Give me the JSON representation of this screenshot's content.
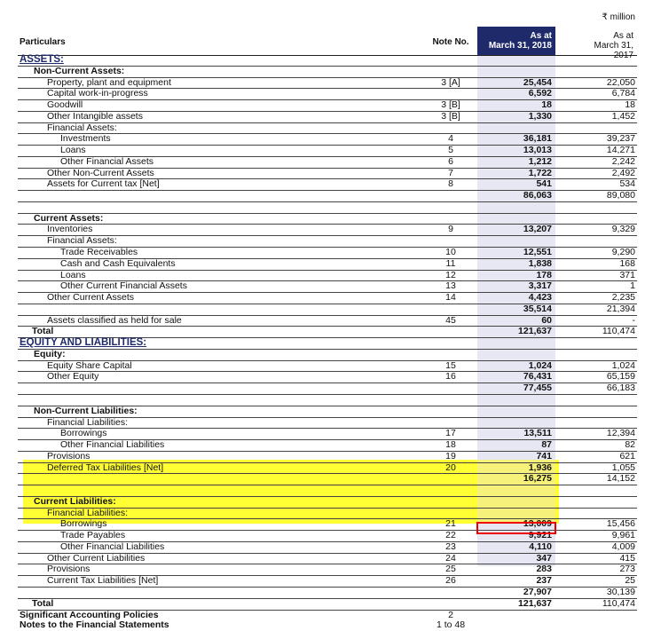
{
  "unit": "₹ million",
  "header": {
    "particulars": "Particulars",
    "note": "Note No.",
    "current_line1": "As at",
    "current_line2": "March 31, 2018",
    "previous_line1": "As at",
    "previous_line2": "March 31, 2017"
  },
  "colors": {
    "header_bg": "#1f2a6b",
    "highlight": "#ffff33",
    "red_box": "#e00000"
  },
  "rows": [
    {
      "level": "0",
      "label": "ASSETS:",
      "note": "",
      "cur": "",
      "prev": ""
    },
    {
      "level": "1",
      "label": "Non-Current Assets:",
      "note": "",
      "cur": "",
      "prev": ""
    },
    {
      "level": "2",
      "label": "Property, plant and equipment",
      "note": "3 [A]",
      "cur": "25,454",
      "prev": "22,050"
    },
    {
      "level": "2",
      "label": "Capital work-in-progress",
      "note": "",
      "cur": "6,592",
      "prev": "6,784"
    },
    {
      "level": "2",
      "label": "Goodwill",
      "note": "3 [B]",
      "cur": "18",
      "prev": "18"
    },
    {
      "level": "2",
      "label": "Other Intangible assets",
      "note": "3 [B]",
      "cur": "1,330",
      "prev": "1,452"
    },
    {
      "level": "2",
      "label": "Financial Assets:",
      "note": "",
      "cur": "",
      "prev": ""
    },
    {
      "level": "3",
      "label": "Investments",
      "note": "4",
      "cur": "36,181",
      "prev": "39,237"
    },
    {
      "level": "3",
      "label": "Loans",
      "note": "5",
      "cur": "13,013",
      "prev": "14,271"
    },
    {
      "level": "3",
      "label": "Other Financial Assets",
      "note": "6",
      "cur": "1,212",
      "prev": "2,242"
    },
    {
      "level": "2",
      "label": "Other Non-Current Assets",
      "note": "7",
      "cur": "1,722",
      "prev": "2,492"
    },
    {
      "level": "2",
      "label": "Assets for Current tax [Net]",
      "note": "8",
      "cur": "541",
      "prev": "534"
    },
    {
      "level": "s",
      "label": "",
      "note": "",
      "cur": "86,063",
      "prev": "89,080"
    },
    {
      "level": "e",
      "label": "",
      "note": "",
      "cur": "",
      "prev": ""
    },
    {
      "level": "1",
      "label": "Current Assets:",
      "note": "",
      "cur": "",
      "prev": ""
    },
    {
      "level": "2",
      "label": "Inventories",
      "note": "9",
      "cur": "13,207",
      "prev": "9,329"
    },
    {
      "level": "2",
      "label": "Financial Assets:",
      "note": "",
      "cur": "",
      "prev": ""
    },
    {
      "level": "3",
      "label": "Trade Receivables",
      "note": "10",
      "cur": "12,551",
      "prev": "9,290"
    },
    {
      "level": "3",
      "label": "Cash and Cash Equivalents",
      "note": "11",
      "cur": "1,838",
      "prev": "168"
    },
    {
      "level": "3",
      "label": "Loans",
      "note": "12",
      "cur": "178",
      "prev": "371"
    },
    {
      "level": "3",
      "label": "Other Current Financial Assets",
      "note": "13",
      "cur": "3,317",
      "prev": "1"
    },
    {
      "level": "2",
      "label": "Other Current Assets",
      "note": "14",
      "cur": "4,423",
      "prev": "2,235"
    },
    {
      "level": "s",
      "label": "",
      "note": "",
      "cur": "35,514",
      "prev": "21,394"
    },
    {
      "level": "2",
      "label": "Assets classified as held for sale",
      "note": "45",
      "cur": "60",
      "prev": "-"
    },
    {
      "level": "t",
      "label": "Total",
      "note": "",
      "cur": "121,637",
      "prev": "110,474"
    },
    {
      "level": "0",
      "label": "EQUITY AND LIABILITIES:",
      "note": "",
      "cur": "",
      "prev": ""
    },
    {
      "level": "1",
      "label": "Equity:",
      "note": "",
      "cur": "",
      "prev": ""
    },
    {
      "level": "2",
      "label": "Equity Share Capital",
      "note": "15",
      "cur": "1,024",
      "prev": "1,024"
    },
    {
      "level": "2",
      "label": "Other Equity",
      "note": "16",
      "cur": "76,431",
      "prev": "65,159"
    },
    {
      "level": "s",
      "label": "",
      "note": "",
      "cur": "77,455",
      "prev": "66,183"
    },
    {
      "level": "e",
      "label": "",
      "note": "",
      "cur": "",
      "prev": ""
    },
    {
      "level": "1",
      "label": "Non-Current Liabilities:",
      "note": "",
      "cur": "",
      "prev": ""
    },
    {
      "level": "2",
      "label": "Financial Liabilities:",
      "note": "",
      "cur": "",
      "prev": ""
    },
    {
      "level": "3",
      "label": "Borrowings",
      "note": "17",
      "cur": "13,511",
      "prev": "12,394"
    },
    {
      "level": "3",
      "label": "Other Financial Liabilities",
      "note": "18",
      "cur": "87",
      "prev": "82"
    },
    {
      "level": "2",
      "label": "Provisions",
      "note": "19",
      "cur": "741",
      "prev": "621"
    },
    {
      "level": "2",
      "label": "Deferred Tax Liabilities [Net]",
      "note": "20",
      "cur": "1,936",
      "prev": "1,055"
    },
    {
      "level": "s",
      "label": "",
      "note": "",
      "cur": "16,275",
      "prev": "14,152"
    },
    {
      "level": "e",
      "label": "",
      "note": "",
      "cur": "",
      "prev": ""
    },
    {
      "level": "1",
      "label": "Current Liabilities:",
      "note": "",
      "cur": "",
      "prev": ""
    },
    {
      "level": "2",
      "label": "Financial Liabilities:",
      "note": "",
      "cur": "",
      "prev": ""
    },
    {
      "level": "3",
      "label": "Borrowings",
      "note": "21",
      "cur": "13,009",
      "prev": "15,456"
    },
    {
      "level": "3",
      "label": "Trade Payables",
      "note": "22",
      "cur": "9,921",
      "prev": "9,961"
    },
    {
      "level": "3",
      "label": "Other Financial Liabilities",
      "note": "23",
      "cur": "4,110",
      "prev": "4,009"
    },
    {
      "level": "2",
      "label": "Other Current Liabilities",
      "note": "24",
      "cur": "347",
      "prev": "415"
    },
    {
      "level": "2",
      "label": "Provisions",
      "note": "25",
      "cur": "283",
      "prev": "273"
    },
    {
      "level": "2",
      "label": "Current Tax Liabilities [Net]",
      "note": "26",
      "cur": "237",
      "prev": "25"
    },
    {
      "level": "s",
      "label": "",
      "note": "",
      "cur": "27,907",
      "prev": "30,139"
    },
    {
      "level": "t",
      "label": "Total",
      "note": "",
      "cur": "121,637",
      "prev": "110,474"
    },
    {
      "level": "b",
      "label": "Significant Accounting Policies",
      "note": "2",
      "cur": "",
      "prev": ""
    },
    {
      "level": "b",
      "label": "Notes to the Financial Statements",
      "note": "1 to 48",
      "cur": "",
      "prev": ""
    }
  ]
}
